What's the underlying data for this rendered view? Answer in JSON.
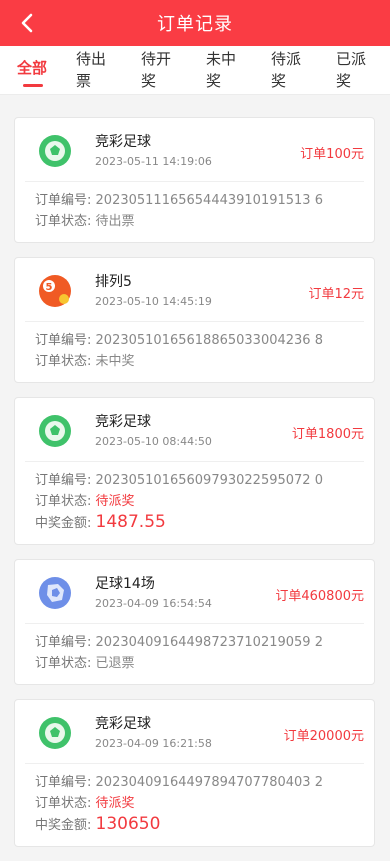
{
  "header": {
    "title": "订单记录"
  },
  "tabs": [
    {
      "label": "全部",
      "active": true
    },
    {
      "label": "待出票",
      "active": false
    },
    {
      "label": "待开奖",
      "active": false
    },
    {
      "label": "未中奖",
      "active": false
    },
    {
      "label": "待派奖",
      "active": false
    },
    {
      "label": "已派奖",
      "active": false
    }
  ],
  "labels": {
    "order_no": "订单编号:",
    "status": "订单状态:",
    "prize": "中奖金额:"
  },
  "orders": [
    {
      "game": "竞彩足球",
      "icon": "soccer-ball-icon",
      "time": "2023-05-11 14:19:06",
      "amount": "订单100元",
      "order_no": "20230511165654443910191513 6",
      "status": "待出票",
      "status_highlight": false,
      "prize": ""
    },
    {
      "game": "排列5",
      "icon": "lottery-5-icon",
      "time": "2023-05-10 14:45:19",
      "amount": "订单12元",
      "order_no": "20230510165618865033004236 8",
      "status": "未中奖",
      "status_highlight": false,
      "prize": ""
    },
    {
      "game": "竞彩足球",
      "icon": "soccer-ball-icon",
      "time": "2023-05-10 08:44:50",
      "amount": "订单1800元",
      "order_no": "20230510165609793022595072 0",
      "status": "待派奖",
      "status_highlight": true,
      "prize": "1487.55"
    },
    {
      "game": "足球14场",
      "icon": "football-14-icon",
      "time": "2023-04-09 16:54:54",
      "amount": "订单460800元",
      "order_no": "20230409164498723710219059 2",
      "status": "已退票",
      "status_highlight": false,
      "prize": ""
    },
    {
      "game": "竞彩足球",
      "icon": "soccer-ball-icon",
      "time": "2023-04-09 16:21:58",
      "amount": "订单20000元",
      "order_no": "20230409164497894707780403 2",
      "status": "待派奖",
      "status_highlight": true,
      "prize": "130650"
    }
  ],
  "colors": {
    "brand_red": "#fa3c44",
    "accent_red": "#f23a3f",
    "soccer_green": "#3fc26a",
    "lottery_orange": "#f05a24",
    "football14_blue": "#6e8fe8"
  }
}
